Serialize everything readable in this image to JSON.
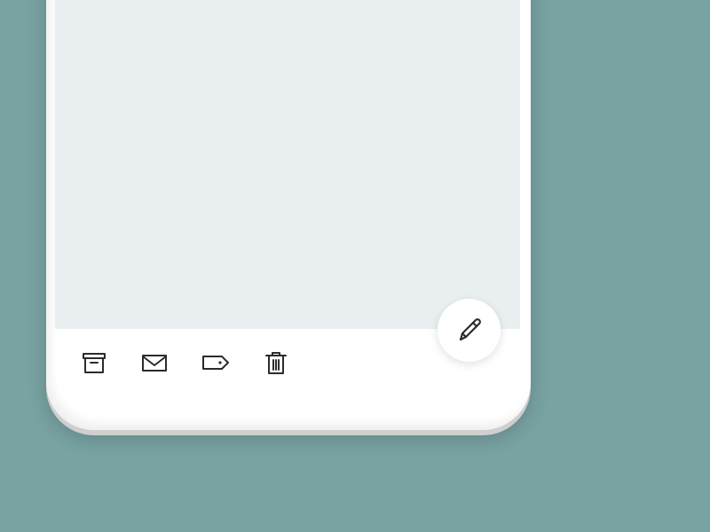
{
  "colors": {
    "background": "#78a3a2",
    "screen_content": "#e9eff0",
    "icon_stroke": "#2b2b2b",
    "frame": "#ffffff"
  },
  "action_bar": {
    "buttons": [
      {
        "icon": "archive-icon"
      },
      {
        "icon": "mail-icon"
      },
      {
        "icon": "label-tag-icon"
      },
      {
        "icon": "trash-icon"
      }
    ]
  },
  "fab": {
    "icon": "pencil-icon"
  }
}
